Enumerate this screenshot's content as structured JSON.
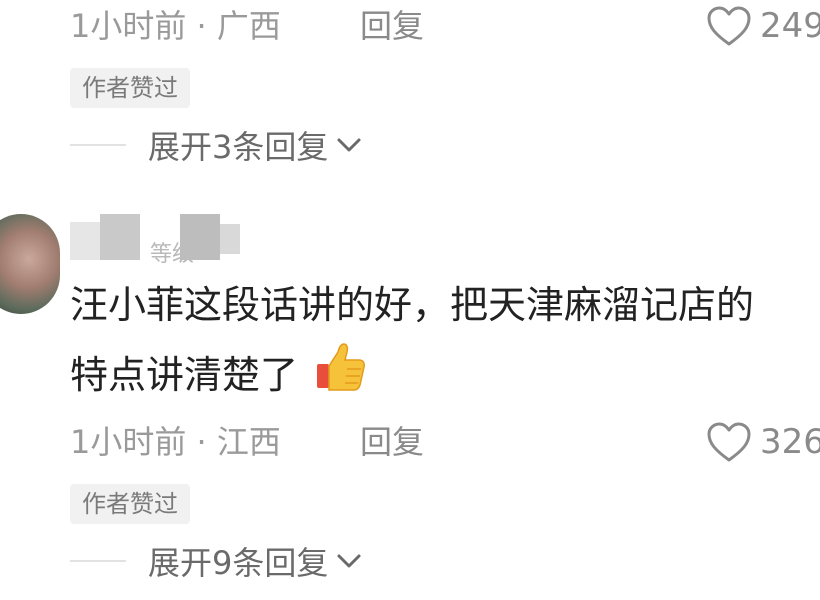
{
  "top_comment": {
    "time": "1小时前",
    "location": "广西",
    "reply_label": "回复",
    "like_count": "249",
    "badge": "作者赞过",
    "expand_label": "展开3条回复"
  },
  "comment": {
    "user_level": "等级",
    "text_line1": "汪小菲这段话讲的好，把天津麻溜记店的",
    "text_line2": "特点讲清楚了",
    "time": "1小时前",
    "location": "江西",
    "reply_label": "回复",
    "like_count": "326",
    "badge": "作者赞过",
    "expand_label": "展开9条回复"
  },
  "icons": {
    "like": "heart-outline-icon",
    "expand": "chevron-down-icon",
    "emoji": "thumbs-up-emoji-icon"
  },
  "colors": {
    "meta_text": "#9a9a9a",
    "comment_text": "#222222",
    "badge_bg": "#f1f1f1"
  }
}
